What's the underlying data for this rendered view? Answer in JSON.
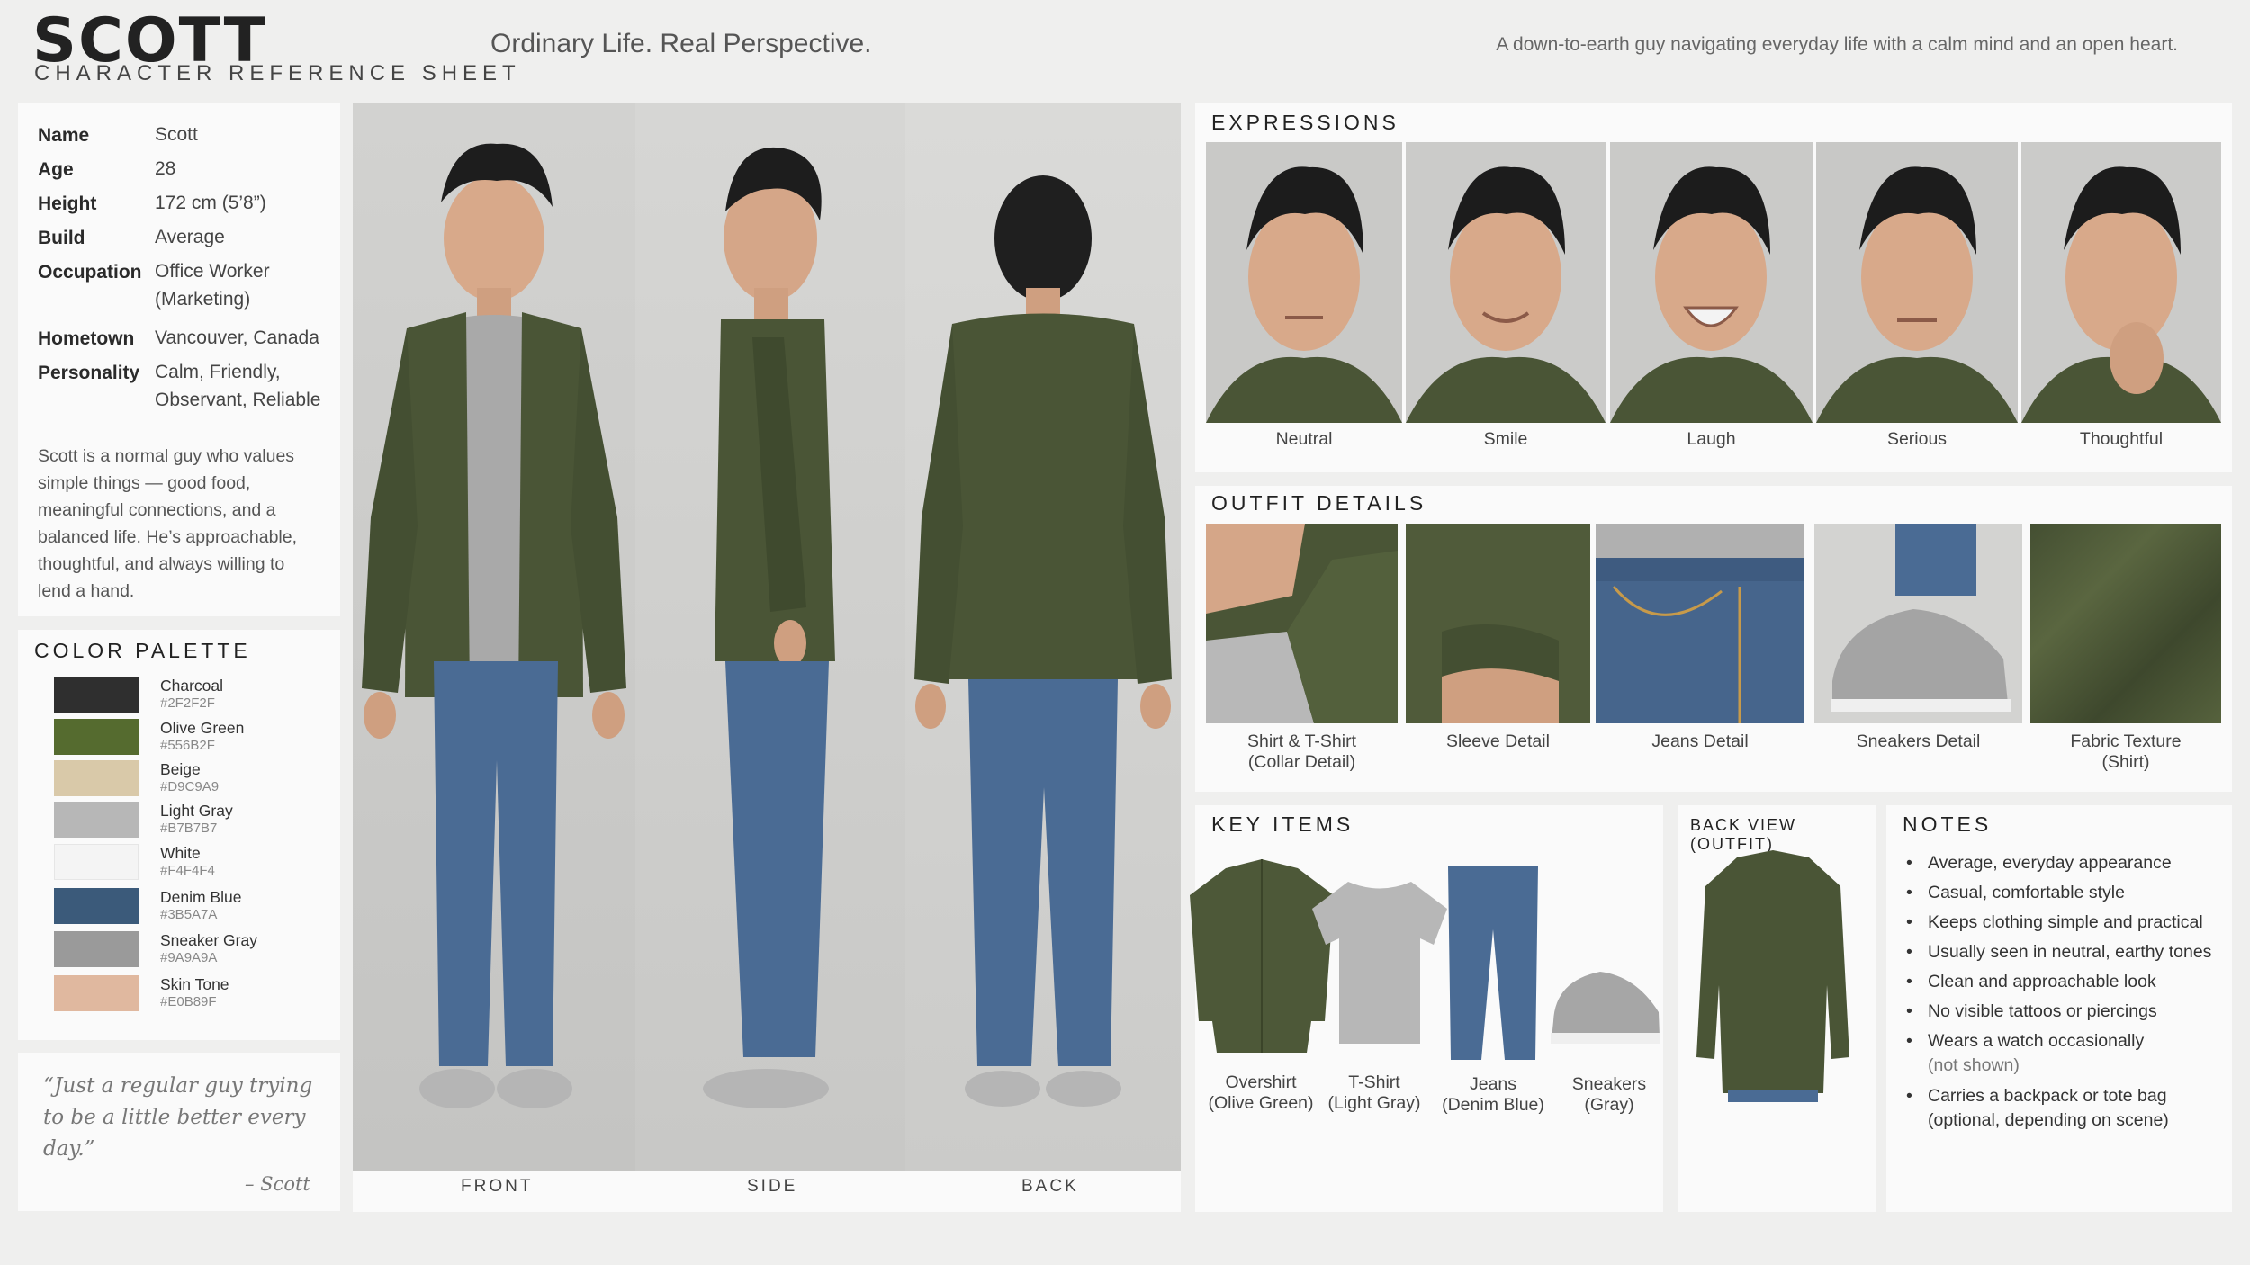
{
  "header": {
    "title": "SCOTT",
    "subtitle": "CHARACTER REFERENCE SHEET",
    "tagline": "Ordinary Life. Real Perspective.",
    "blurb": "A down-to-earth guy navigating everyday life with a calm mind and an open heart."
  },
  "profile": {
    "rows": [
      {
        "label": "Name",
        "value": "Scott"
      },
      {
        "label": "Age",
        "value": "28"
      },
      {
        "label": "Height",
        "value": "172 cm (5’8”)"
      },
      {
        "label": "Build",
        "value": "Average"
      },
      {
        "label": "Occupation",
        "value": "Office Worker (Marketing)"
      },
      {
        "label": "Hometown",
        "value": "Vancouver, Canada"
      },
      {
        "label": "Personality",
        "value": "Calm, Friendly, Observant, Reliable"
      }
    ],
    "bio": "Scott is a normal guy who values simple things — good food, meaningful connections, and a balanced life. He’s approachable, thoughtful, and always willing to lend a hand."
  },
  "palette": {
    "heading": "COLOR PALETTE",
    "colors": [
      {
        "name": "Charcoal",
        "hex": "#2F2F2F"
      },
      {
        "name": "Olive Green",
        "hex": "#556B2F"
      },
      {
        "name": "Beige",
        "hex": "#D9C9A9"
      },
      {
        "name": "Light Gray",
        "hex": "#B7B7B7"
      },
      {
        "name": "White",
        "hex": "#F4F4F4"
      },
      {
        "name": "Denim Blue",
        "hex": "#3B5A7A"
      },
      {
        "name": "Sneaker Gray",
        "hex": "#9A9A9A"
      },
      {
        "name": "Skin Tone",
        "hex": "#E0B89F"
      }
    ]
  },
  "quote": {
    "text": "“Just a regular guy trying to be a little better every day.”",
    "author": "– Scott"
  },
  "views": {
    "labels": [
      "FRONT",
      "SIDE",
      "BACK"
    ]
  },
  "expressions": {
    "heading": "EXPRESSIONS",
    "items": [
      "Neutral",
      "Smile",
      "Laugh",
      "Serious",
      "Thoughtful"
    ]
  },
  "outfit": {
    "heading": "OUTFIT DETAILS",
    "items": [
      {
        "line1": "Shirt & T-Shirt",
        "line2": "(Collar Detail)"
      },
      {
        "line1": "Sleeve Detail",
        "line2": ""
      },
      {
        "line1": "Jeans Detail",
        "line2": ""
      },
      {
        "line1": "Sneakers Detail",
        "line2": ""
      },
      {
        "line1": "Fabric Texture",
        "line2": "(Shirt)"
      }
    ]
  },
  "key_items": {
    "heading": "KEY ITEMS",
    "items": [
      {
        "line1": "Overshirt",
        "line2": "(Olive Green)"
      },
      {
        "line1": "T-Shirt",
        "line2": "(Light Gray)"
      },
      {
        "line1": "Jeans",
        "line2": "(Denim Blue)"
      },
      {
        "line1": "Sneakers",
        "line2": "(Gray)"
      }
    ]
  },
  "back_view": {
    "heading": "BACK VIEW (OUTFIT)"
  },
  "notes": {
    "heading": "NOTES",
    "items": [
      {
        "text": "Average, everyday appearance",
        "sub": ""
      },
      {
        "text": "Casual, comfortable style",
        "sub": ""
      },
      {
        "text": "Keeps clothing simple and practical",
        "sub": ""
      },
      {
        "text": "Usually seen in neutral, earthy tones",
        "sub": ""
      },
      {
        "text": "Clean and approachable look",
        "sub": ""
      },
      {
        "text": "No visible tattoos or piercings",
        "sub": ""
      },
      {
        "text": "Wears a watch occasionally",
        "sub": "(not shown)"
      },
      {
        "text": "Carries a backpack or tote bag",
        "sub": "(optional, depending on scene)"
      }
    ]
  }
}
